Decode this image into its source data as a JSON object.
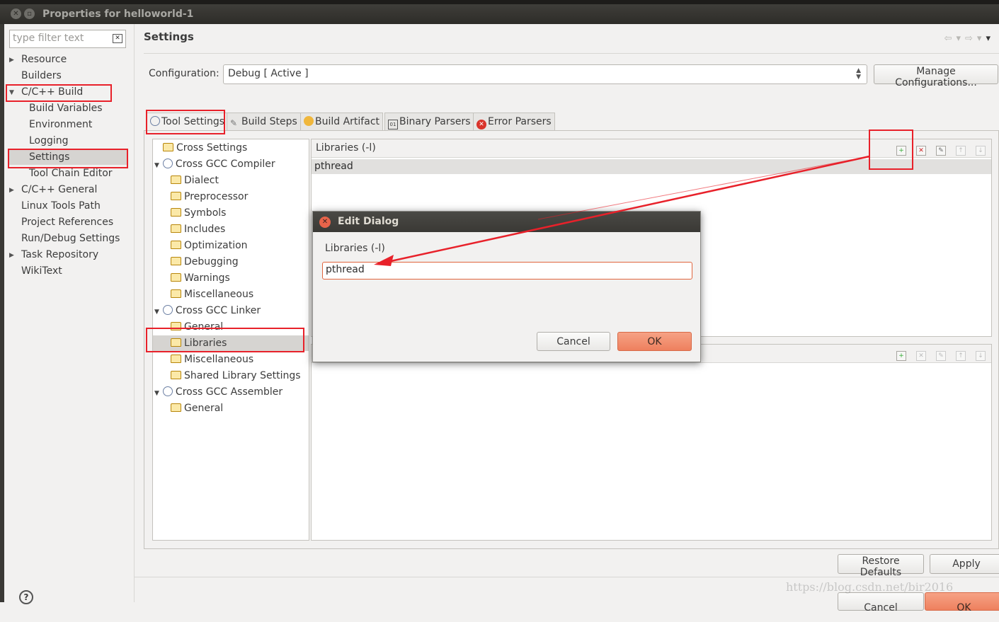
{
  "window": {
    "title": "Properties for helloworld-1"
  },
  "sidebar": {
    "filter_placeholder": "type filter text",
    "items": [
      {
        "label": "Resource"
      },
      {
        "label": "Builders"
      },
      {
        "label": "C/C++ Build"
      },
      {
        "label": "Build Variables"
      },
      {
        "label": "Environment"
      },
      {
        "label": "Logging"
      },
      {
        "label": "Settings"
      },
      {
        "label": "Tool Chain Editor"
      },
      {
        "label": "C/C++ General"
      },
      {
        "label": "Linux Tools Path"
      },
      {
        "label": "Project References"
      },
      {
        "label": "Run/Debug Settings"
      },
      {
        "label": "Task Repository"
      },
      {
        "label": "WikiText"
      }
    ]
  },
  "main": {
    "heading": "Settings",
    "configuration_label": "Configuration:",
    "configuration_value": "Debug  [ Active ]",
    "manage_button": "Manage Configurations...",
    "tabs": [
      {
        "label": "Tool Settings"
      },
      {
        "label": "Build Steps"
      },
      {
        "label": "Build Artifact"
      },
      {
        "label": "Binary Parsers"
      },
      {
        "label": "Error Parsers"
      }
    ],
    "tree": [
      {
        "label": "Cross Settings"
      },
      {
        "label": "Cross GCC Compiler"
      },
      {
        "label": "Dialect"
      },
      {
        "label": "Preprocessor"
      },
      {
        "label": "Symbols"
      },
      {
        "label": "Includes"
      },
      {
        "label": "Optimization"
      },
      {
        "label": "Debugging"
      },
      {
        "label": "Warnings"
      },
      {
        "label": "Miscellaneous"
      },
      {
        "label": "Cross GCC Linker"
      },
      {
        "label": "General"
      },
      {
        "label": "Libraries"
      },
      {
        "label": "Miscellaneous"
      },
      {
        "label": "Shared Library Settings"
      },
      {
        "label": "Cross GCC Assembler"
      },
      {
        "label": "General"
      }
    ],
    "libraries_panel": {
      "title": "Libraries (-l)",
      "rows": [
        "pthread"
      ]
    },
    "restore_defaults": "Restore Defaults",
    "apply": "Apply"
  },
  "dialog": {
    "title": "Edit Dialog",
    "label": "Libraries (-l)",
    "value": "pthread",
    "cancel": "Cancel",
    "ok": "OK"
  },
  "footer": {
    "cancel": "Cancel",
    "ok": "OK"
  },
  "watermark": "https://blog.csdn.net/bir2016",
  "colors": {
    "annotation_red": "#e8212a",
    "ok_button": "#ee805e",
    "title_bar": "#3f3e3a"
  }
}
